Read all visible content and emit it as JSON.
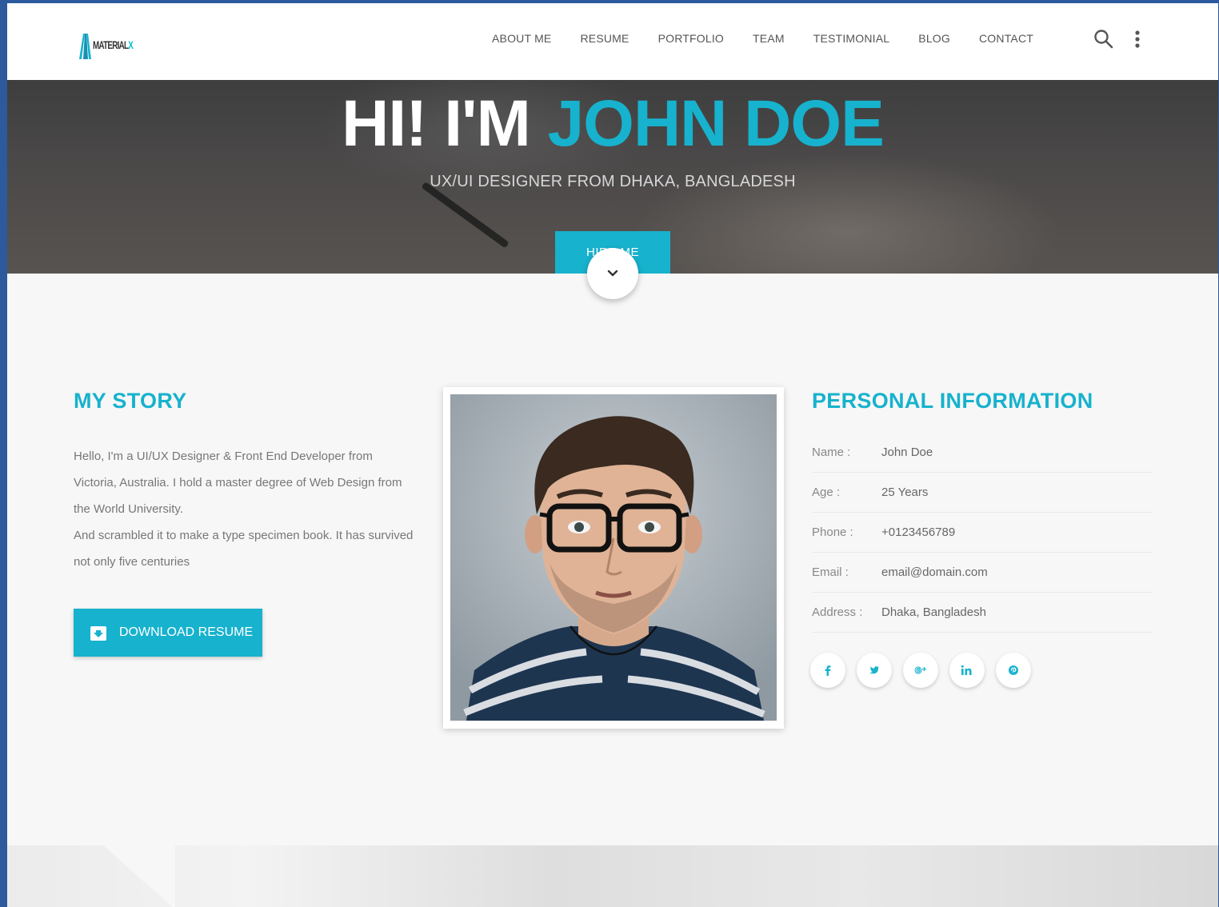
{
  "brand": {
    "logo_text": "MATERIAL",
    "logo_accent": "X"
  },
  "nav": {
    "items": [
      {
        "label": "ABOUT ME"
      },
      {
        "label": "RESUME"
      },
      {
        "label": "PORTFOLIO"
      },
      {
        "label": "TEAM"
      },
      {
        "label": "TESTIMONIAL"
      },
      {
        "label": "BLOG"
      },
      {
        "label": "CONTACT"
      }
    ]
  },
  "hero": {
    "title_prefix": "HI! I'M ",
    "title_name": "JOHN DOE",
    "subtitle": "UX/UI DESIGNER FROM DHAKA, BANGLADESH",
    "button_label": "HIRE ME"
  },
  "story": {
    "title": "MY STORY",
    "paragraph1": "Hello, I'm a UI/UX Designer & Front End Developer from Victoria, Australia. I hold a master degree of Web Design from the World University.",
    "paragraph2": "And scrambled it to make a type specimen book. It has survived not only five centuries",
    "download_label": "DOWNLOAD RESUME"
  },
  "personal_info": {
    "title": "PERSONAL INFORMATION",
    "rows": [
      {
        "key": "Name :",
        "value": "John Doe"
      },
      {
        "key": "Age :",
        "value": "25 Years"
      },
      {
        "key": "Phone :",
        "value": "+0123456789"
      },
      {
        "key": "Email :",
        "value": "email@domain.com"
      },
      {
        "key": "Address :",
        "value": "Dhaka, Bangladesh"
      }
    ]
  },
  "social": [
    {
      "icon": "facebook-icon",
      "glyph": "f"
    },
    {
      "icon": "twitter-icon",
      "glyph": "t"
    },
    {
      "icon": "google-plus-icon",
      "glyph": "g+"
    },
    {
      "icon": "linkedin-icon",
      "glyph": "in"
    },
    {
      "icon": "pinterest-icon",
      "glyph": "p"
    }
  ],
  "colors": {
    "accent": "#17b2cd",
    "frame": "#2c5a9c"
  }
}
